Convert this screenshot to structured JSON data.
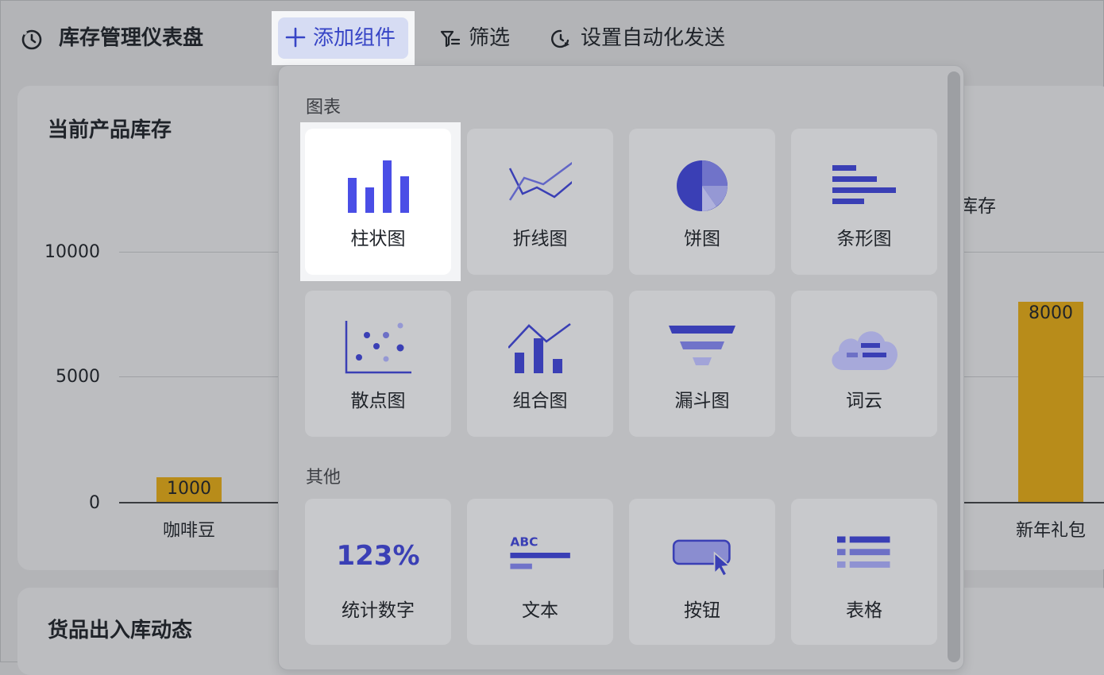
{
  "header": {
    "title": "库存管理仪表盘",
    "add_widget_label": "添加组件",
    "filter_label": "筛选",
    "auto_send_label": "设置自动化发送",
    "icons": {
      "dashboard": "dashboard-clock-icon",
      "add": "plus-icon",
      "filter": "filter-icon",
      "auto_send": "clock-send-icon"
    },
    "accent_color": "#3745c6"
  },
  "inventory_card": {
    "title": "当前产品库存",
    "right_partial_title": "库存",
    "chart_data": {
      "type": "bar",
      "title": "当前产品库存",
      "y_ticks": [
        "10000",
        "5000",
        "0"
      ],
      "ylim": [
        0,
        10000
      ],
      "categories": [
        "咖啡豆",
        "新年礼包"
      ],
      "values": [
        1000,
        8000
      ],
      "value_labels": [
        "1000",
        "8000"
      ],
      "bar_color": "#b88c1a"
    }
  },
  "movement_card": {
    "title": "货品出入库动态"
  },
  "widget_menu": {
    "sections": [
      {
        "label": "图表",
        "items": [
          {
            "label": "柱状图",
            "icon": "bar-chart-icon",
            "selected": true
          },
          {
            "label": "折线图",
            "icon": "line-chart-icon"
          },
          {
            "label": "饼图",
            "icon": "pie-chart-icon"
          },
          {
            "label": "条形图",
            "icon": "horizontal-bar-chart-icon"
          },
          {
            "label": "散点图",
            "icon": "scatter-chart-icon"
          },
          {
            "label": "组合图",
            "icon": "combo-chart-icon"
          },
          {
            "label": "漏斗图",
            "icon": "funnel-chart-icon"
          },
          {
            "label": "词云",
            "icon": "word-cloud-icon"
          }
        ]
      },
      {
        "label": "其他",
        "items": [
          {
            "label": "统计数字",
            "icon": "stat-number-icon",
            "glyph": "123%"
          },
          {
            "label": "文本",
            "icon": "text-icon",
            "glyph": "ABC"
          },
          {
            "label": "按钮",
            "icon": "button-icon"
          },
          {
            "label": "表格",
            "icon": "table-icon"
          }
        ]
      }
    ]
  }
}
